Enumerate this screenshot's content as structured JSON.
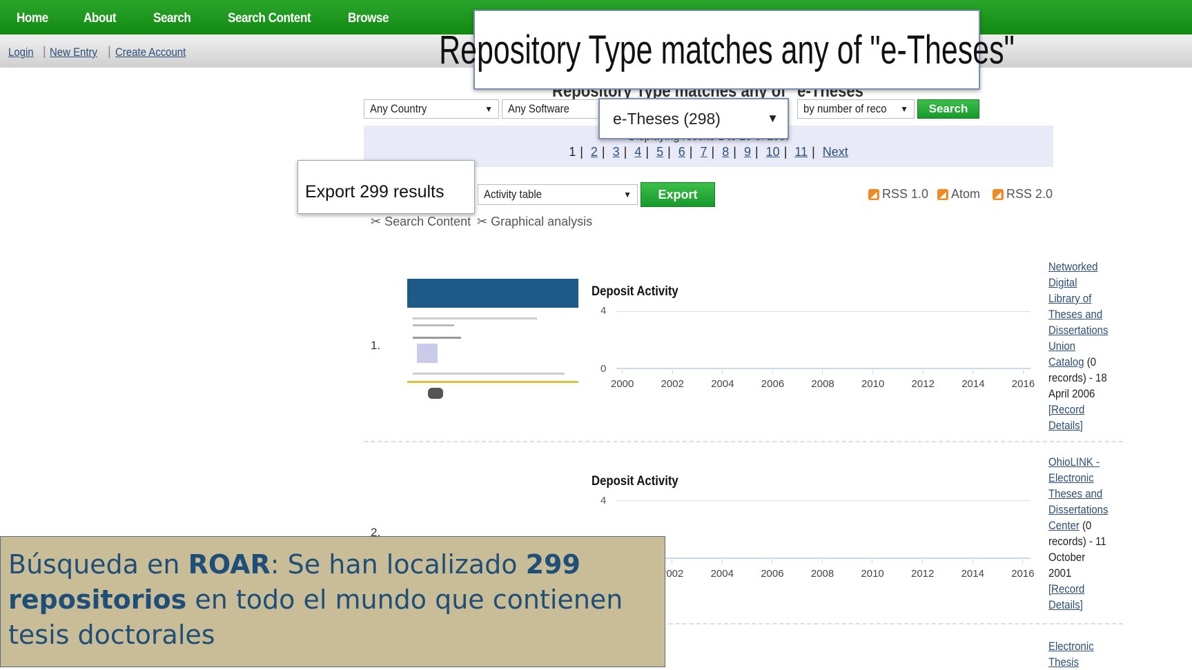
{
  "nav": {
    "items": [
      "Home",
      "About",
      "Search",
      "Search Content",
      "Browse"
    ]
  },
  "subnav": {
    "login": "Login",
    "new_entry": "New Entry",
    "create_account": "Create Account",
    "separator": "|"
  },
  "overlay_title": "Repository Type matches any of \"e-Theses\"",
  "page_title": "Repository Type matches any of \"e-Theses\"",
  "filters": {
    "country": "Any Country",
    "software": "Any Software",
    "type": "e-Theses (298)",
    "sort": "by number of reco",
    "search_button": "Search"
  },
  "pager": {
    "displaying": "Displaying results 1 to 20 of 299.",
    "current": "1",
    "pages": [
      "2",
      "3",
      "4",
      "5",
      "6",
      "7",
      "8",
      "9",
      "10",
      "11"
    ],
    "next": "Next",
    "separator": "|"
  },
  "export": {
    "label": "Export 299 results",
    "format": "Activity table",
    "button": "Export"
  },
  "feeds": [
    "RSS 1.0",
    "Atom",
    "RSS 2.0"
  ],
  "tools": {
    "search_content": "Search Content",
    "graphical_analysis": "Graphical analysis"
  },
  "results": [
    {
      "number": "1.",
      "chart_title": "Deposit Activity",
      "y_max": "4",
      "y_min": "0",
      "years": [
        "2000",
        "2002",
        "2004",
        "2006",
        "2008",
        "2010",
        "2012",
        "2014",
        "2016"
      ],
      "name_lines": [
        "Networked",
        "Digital",
        "Library of",
        "Theses and",
        "Dissertations",
        "Union",
        "Catalog"
      ],
      "records": "(0",
      "records2": "records) - 18",
      "date": "April 2006",
      "details1": "[Record",
      "details2": "Details]"
    },
    {
      "number": "2.",
      "chart_title": "Deposit Activity",
      "y_max": "4",
      "years": [
        "2002",
        "2004",
        "2006",
        "2008",
        "2010",
        "2012",
        "2014",
        "2016"
      ],
      "name_lines": [
        "OhioLINK -",
        "Electronic",
        "Theses and",
        "Dissertations",
        "Center"
      ],
      "records": "(0",
      "records2": "records) - 11",
      "date1": "October",
      "date2": "2001",
      "details1": "[Record",
      "details2": "Details]"
    },
    {
      "name_lines": [
        "Electronic",
        "Thesis"
      ]
    }
  ],
  "note": {
    "part1": "Búsqueda en ",
    "bold1": "ROAR",
    "part2": ": Se han localizado ",
    "bold2": "299 repositorios",
    "part3": " en todo el mundo que contienen tesis doctorales"
  },
  "colors": {
    "nav_green": "#1e9a1e",
    "link_blue": "#2c4f7a",
    "note_bg": "#c8bd96",
    "note_text": "#1f4e79"
  }
}
